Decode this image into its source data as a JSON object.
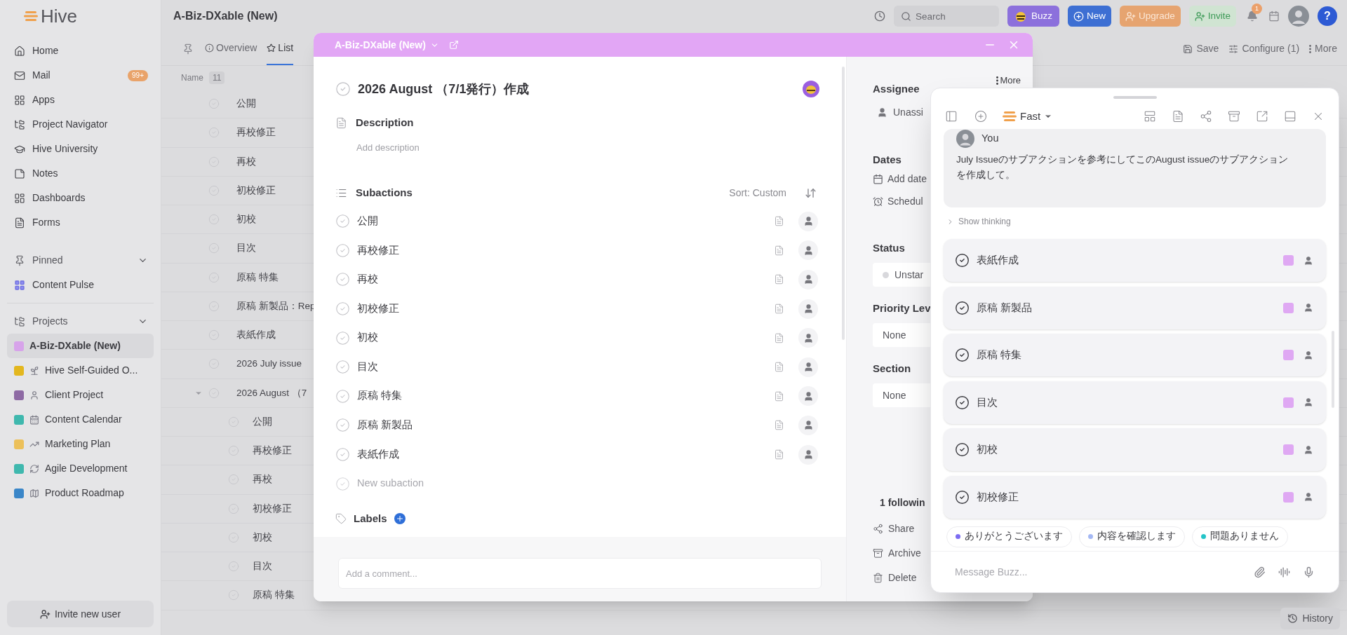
{
  "logo": {
    "text": "Hive"
  },
  "sidebar": {
    "nav": [
      {
        "label": "Home"
      },
      {
        "label": "Mail",
        "badge": "99+"
      },
      {
        "label": "Apps"
      },
      {
        "label": "Project Navigator"
      },
      {
        "label": "Hive University"
      },
      {
        "label": "Notes"
      },
      {
        "label": "Dashboards"
      },
      {
        "label": "Forms"
      }
    ],
    "pinned": {
      "title": "Pinned",
      "expanded": true,
      "items": [
        {
          "label": "Content Pulse"
        }
      ]
    },
    "projects": {
      "title": "Projects",
      "expanded": true,
      "items": [
        {
          "label": "A-Biz-DXable (New)",
          "color": "#d7a3ea",
          "selected": true
        },
        {
          "label": "Hive Self-Guided O...",
          "color": "#e3b71f",
          "selected": false
        },
        {
          "label": "Client Project",
          "color": "#8e6aa4",
          "selected": false
        },
        {
          "label": "Content Calendar",
          "color": "#3fb8ae",
          "selected": false
        },
        {
          "label": "Marketing Plan",
          "color": "#ecc05a",
          "selected": false
        },
        {
          "label": "Agile Development",
          "color": "#3fb8ae",
          "selected": false
        },
        {
          "label": "Product Roadmap",
          "color": "#3a86c8",
          "selected": false
        }
      ]
    },
    "invite_button": "Invite new user"
  },
  "topbar": {
    "title": "A-Biz-DXable (New)",
    "search": {
      "placeholder": "Search"
    },
    "buttons": [
      {
        "kind": "buzz",
        "label": "Buzz"
      },
      {
        "kind": "new",
        "label": "New"
      },
      {
        "kind": "upgrade",
        "label": "Upgrade"
      },
      {
        "kind": "invite",
        "label": "Invite"
      }
    ],
    "notifications": "1",
    "help": "?"
  },
  "view": {
    "tabs": [
      {
        "label": "Overview",
        "selected": false
      },
      {
        "label": "List",
        "selected": true
      }
    ],
    "actions": [
      {
        "kind": "save",
        "label": "Save"
      },
      {
        "kind": "configure",
        "label": "Configure (1)"
      },
      {
        "kind": "more",
        "label": "More"
      }
    ],
    "column": {
      "label": "Name",
      "count": "11"
    },
    "rows": [
      {
        "name": "公開"
      },
      {
        "name": "再校修正"
      },
      {
        "name": "再校"
      },
      {
        "name": "初校修正"
      },
      {
        "name": "初校"
      },
      {
        "name": "目次"
      },
      {
        "name": "原稿 特集"
      },
      {
        "name": "原稿 新製品：Rep"
      },
      {
        "name": "表紙作成"
      },
      {
        "name": "2026 July issue"
      },
      {
        "name": "2026 August （7",
        "expanded": true,
        "children": [
          {
            "name": "公開"
          },
          {
            "name": "再校修正"
          },
          {
            "name": "再校"
          },
          {
            "name": "初校修正"
          },
          {
            "name": "初校"
          },
          {
            "name": "目次"
          },
          {
            "name": "原稿 特集"
          }
        ]
      }
    ]
  },
  "history_button": "History",
  "modal": {
    "project": "A-Biz-DXable (New)",
    "title": "2026 August （7/1発行）作成",
    "description": {
      "label": "Description",
      "placeholder": "Add description"
    },
    "subactions": {
      "label": "Subactions",
      "sort": "Sort: Custom",
      "items": [
        "公開",
        "再校修正",
        "再校",
        "初校修正",
        "初校",
        "目次",
        "原稿 特集",
        "原稿 新製品",
        "表紙作成"
      ],
      "new_placeholder": "New subaction"
    },
    "labels": "Labels",
    "comment_placeholder": "Add a comment...",
    "side": {
      "more": "More",
      "assignee": {
        "label": "Assignee",
        "value": "Unassi"
      },
      "dates": {
        "label": "Dates",
        "items": [
          {
            "kind": "date",
            "text": "Add date"
          },
          {
            "kind": "schedule",
            "text": "Schedul"
          }
        ]
      },
      "selects": [
        {
          "kind": "status",
          "label": "Status",
          "value": "Unstar"
        },
        {
          "kind": "plain",
          "label": "Priority Lev",
          "value": "None"
        },
        {
          "kind": "plain",
          "label": "Section",
          "value": "None"
        }
      ],
      "followers": "1 followin",
      "actions": [
        {
          "kind": "share",
          "label": "Share"
        },
        {
          "kind": "archive",
          "label": "Archive"
        },
        {
          "kind": "delete",
          "label": "Delete"
        }
      ]
    }
  },
  "buzz": {
    "model": "Fast",
    "message": {
      "author": "You",
      "text": "July Issueのサブアクションを参考にしてこのAugust issueのサブアクションを作成して。"
    },
    "show_thinking": "Show thinking",
    "tasks": [
      {
        "name": "表紙作成",
        "color": "#dfa8f3"
      },
      {
        "name": "原稿 新製品",
        "color": "#dfa8f3"
      },
      {
        "name": "原稿 特集",
        "color": "#dfa8f3"
      },
      {
        "name": "目次",
        "color": "#dfa8f3"
      },
      {
        "name": "初校",
        "color": "#dfa8f3"
      },
      {
        "name": "初校修正",
        "color": "#dfa8f3"
      }
    ],
    "suggestions": [
      {
        "label": "ありがとうございます",
        "color": "#7c6cf2"
      },
      {
        "label": "内容を確認します",
        "color": "#a4b8f4"
      },
      {
        "label": "問題ありません",
        "color": "#24c4c8"
      }
    ],
    "placeholder": "Message Buzz..."
  }
}
